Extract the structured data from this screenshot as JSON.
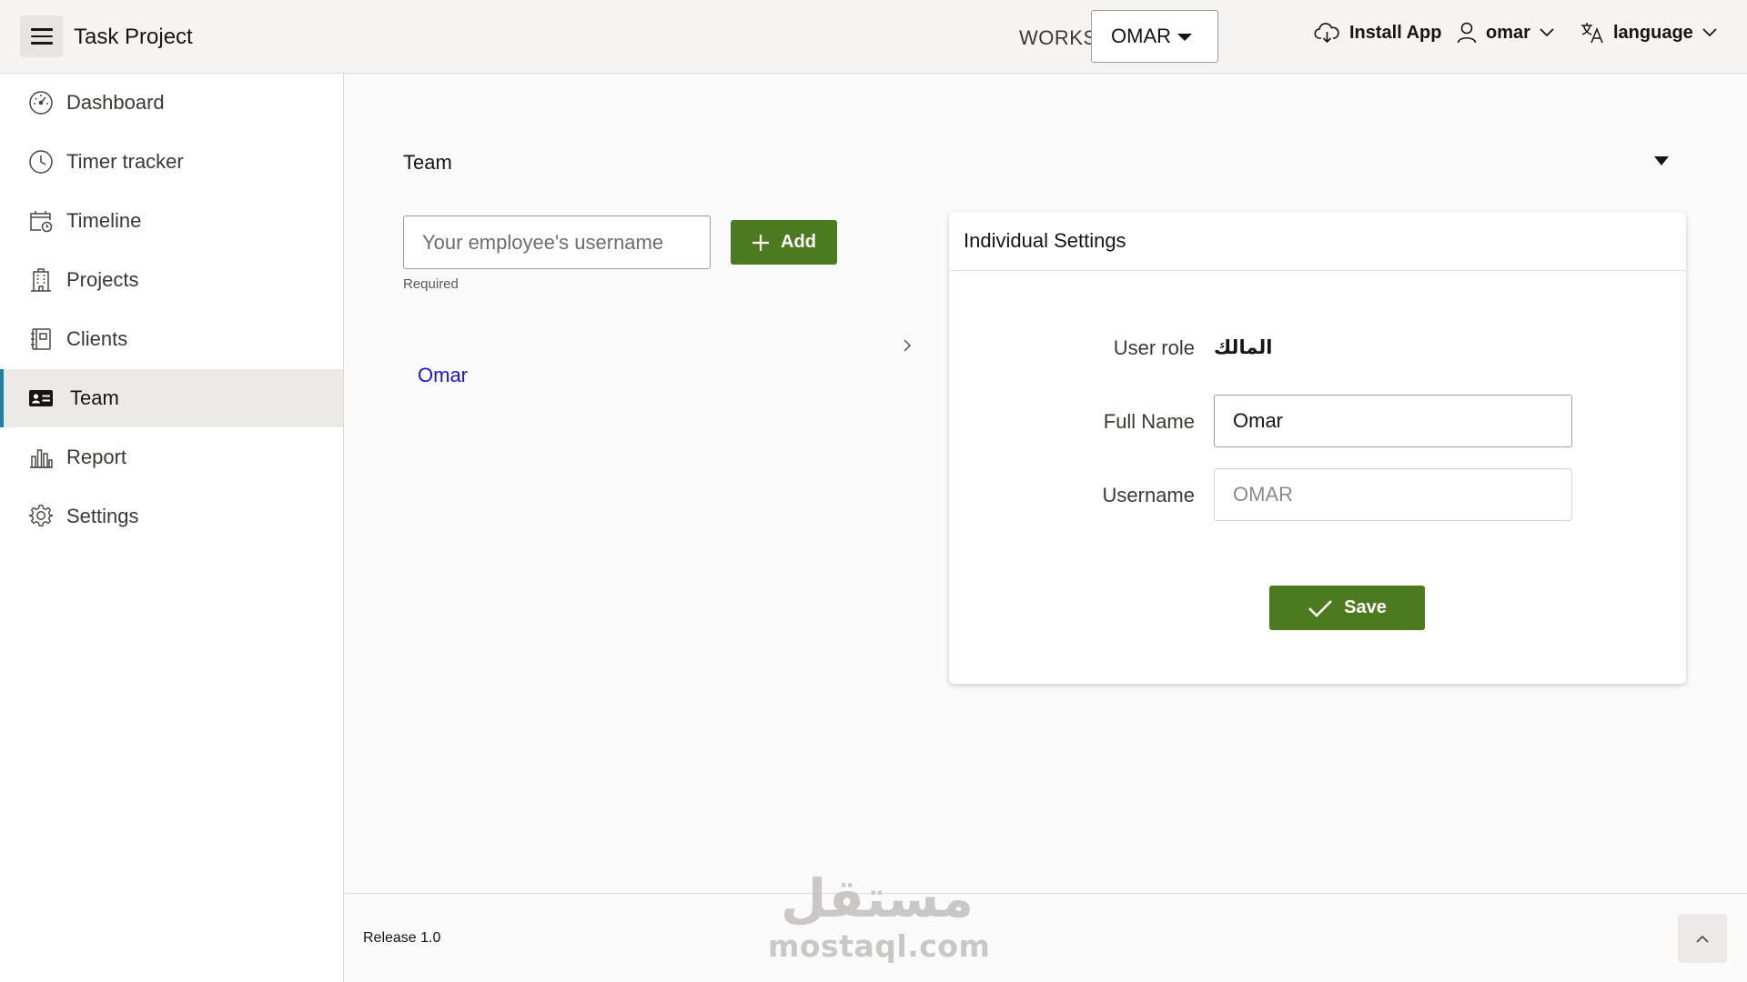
{
  "header": {
    "app_title": "Task Project",
    "workspace_label": "WORKS",
    "workspace_value": "OMAR",
    "install_label": "Install App",
    "user_label": "omar",
    "language_label": "language"
  },
  "sidebar": {
    "items": [
      {
        "label": "Dashboard",
        "icon": "dashboard-icon",
        "active": false
      },
      {
        "label": "Timer tracker",
        "icon": "clock-icon",
        "active": false
      },
      {
        "label": "Timeline",
        "icon": "calendar-clock-icon",
        "active": false
      },
      {
        "label": "Projects",
        "icon": "building-icon",
        "active": false
      },
      {
        "label": "Clients",
        "icon": "address-book-icon",
        "active": false
      },
      {
        "label": "Team",
        "icon": "id-card-icon",
        "active": true
      },
      {
        "label": "Report",
        "icon": "bar-chart-icon",
        "active": false
      },
      {
        "label": "Settings",
        "icon": "gear-icon",
        "active": false
      }
    ]
  },
  "team": {
    "title": "Team",
    "input_placeholder": "Your employee's username",
    "required_text": "Required",
    "add_label": "Add",
    "members": [
      "Omar"
    ]
  },
  "settings_card": {
    "title": "Individual Settings",
    "user_role_label": "User role",
    "user_role_value": "المالك",
    "full_name_label": "Full Name",
    "full_name_value": "Omar",
    "username_label": "Username",
    "username_value": "OMAR",
    "save_label": "Save"
  },
  "footer": {
    "release": "Release 1.0",
    "watermark_ar": "مستقل",
    "watermark_en": "mostaql.com"
  },
  "colors": {
    "accent_green": "#4b7a1f",
    "active_bar": "#227e9e",
    "link_blue": "#1616e0"
  }
}
